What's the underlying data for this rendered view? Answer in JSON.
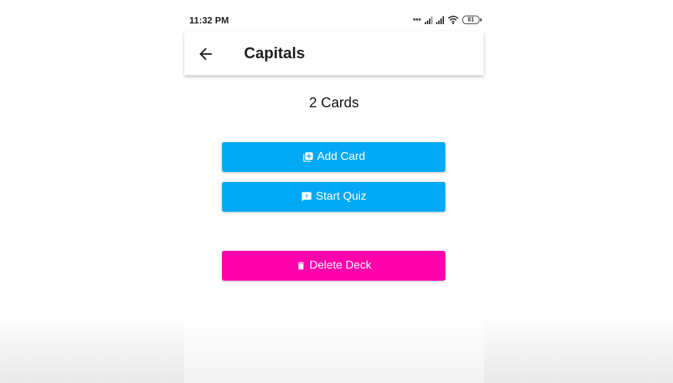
{
  "status_bar": {
    "time": "11:32 PM",
    "battery": "81"
  },
  "app_bar": {
    "title": "Capitals"
  },
  "deck": {
    "card_count": "2 Cards"
  },
  "buttons": {
    "add_card": "Add Card",
    "start_quiz": "Start Quiz",
    "delete_deck": "Delete Deck"
  },
  "colors": {
    "primary": "#03a9f4",
    "danger": "#ff00aa"
  },
  "icons": {
    "back": "arrow-left-icon",
    "add_card": "library-add-icon",
    "start_quiz": "feedback-question-icon",
    "delete_deck": "trash-icon"
  }
}
